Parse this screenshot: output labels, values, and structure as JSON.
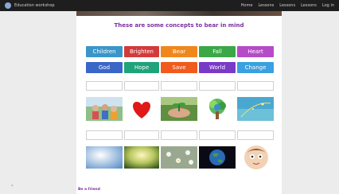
{
  "site": {
    "brand": "Education workshop",
    "nav": [
      "Home",
      "Lessons",
      "Lessons",
      "Lessons",
      "Log in"
    ]
  },
  "activity": {
    "title": "These are some concepts to bear in mind",
    "words_row1": [
      "Children",
      "Brighten",
      "Bear",
      "Fall",
      "Heart"
    ],
    "words_row2": [
      "God",
      "Hope",
      "Save",
      "World",
      "Change"
    ],
    "footer": "Be a friend"
  },
  "colors": {
    "title": "#7b2fa3",
    "children": "#3a96c8",
    "brighten": "#d33a3a",
    "bear": "#f0871c",
    "fall": "#3aa846",
    "heart": "#b54bc8",
    "god": "#3a66c8",
    "hope": "#1fa37a",
    "save": "#f05a1c",
    "world": "#7a3ac8",
    "change": "#3aa0e0"
  },
  "images": [
    "family-photo",
    "red-heart",
    "hands-with-plant",
    "world-tree",
    "sparkle-blue",
    "sky-light",
    "sun-forest",
    "daisy-flowers",
    "earth-globe",
    "cartoon-face"
  ]
}
